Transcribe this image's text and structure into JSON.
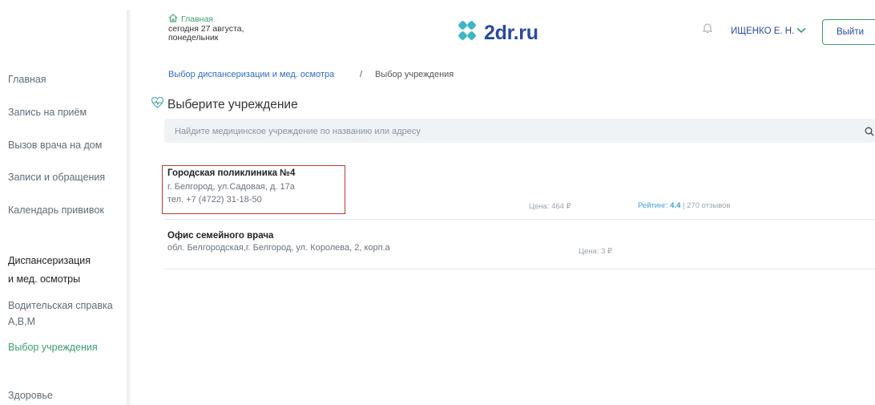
{
  "sidebar": {
    "items": [
      {
        "label": "Главная"
      },
      {
        "label": "Запись на приём"
      },
      {
        "label": "Вызов врача на дом"
      },
      {
        "label": "Записи и обращения"
      },
      {
        "label": "Календарь прививок"
      }
    ],
    "section_title_line1": "Диспансеризация",
    "section_title_line2": "и мед. осмотры",
    "sub_item_line1": "Водительская справка",
    "sub_item_line2": "A,B,M",
    "active_item": "Выбор учреждения",
    "bottom_item": "Здоровье"
  },
  "header": {
    "home_link": "Главная",
    "date_line1": "сегодня 27 августа,",
    "date_line2": "понедельник",
    "logo_text": "2dr.ru",
    "user_name": "ИЩЕНКО Е. Н.",
    "logout_label": "Выйти"
  },
  "breadcrumb": {
    "link": "Выбор диспансеризации и мед. осмотра",
    "separator": "/",
    "current": "Выбор учреждения"
  },
  "page": {
    "title": "Выберите учреждение"
  },
  "search": {
    "placeholder": "Найдите медицинское учреждение по названию или адресу",
    "value": ""
  },
  "clinics": [
    {
      "name": "Городская поликлиника №4",
      "address": "г. Белгород, ул.Садовая, д. 17а",
      "phone": "тел. +7 (4722) 31-18-50",
      "price": "Цена: 464 ₽",
      "rating_label": "Рейтинг:",
      "rating_value": "4.4",
      "reviews": "| 270 отзывов"
    },
    {
      "name": "Офис семейного врача",
      "address": "обл. Белгородская,г. Белгород, ул. Королева, 2, корп.а",
      "price": "Цена: 3 ₽"
    }
  ],
  "colors": {
    "accent_green": "#3a9d6c",
    "brand_blue": "#2b4a9e",
    "link_blue": "#2b6dc5",
    "highlight_red": "#b93a32"
  },
  "icons": {
    "home": "home-icon",
    "logo": "clover-logo-icon",
    "bell": "bell-icon",
    "chevron": "chevron-down-icon",
    "title": "heart-pulse-icon",
    "search": "search-icon"
  }
}
